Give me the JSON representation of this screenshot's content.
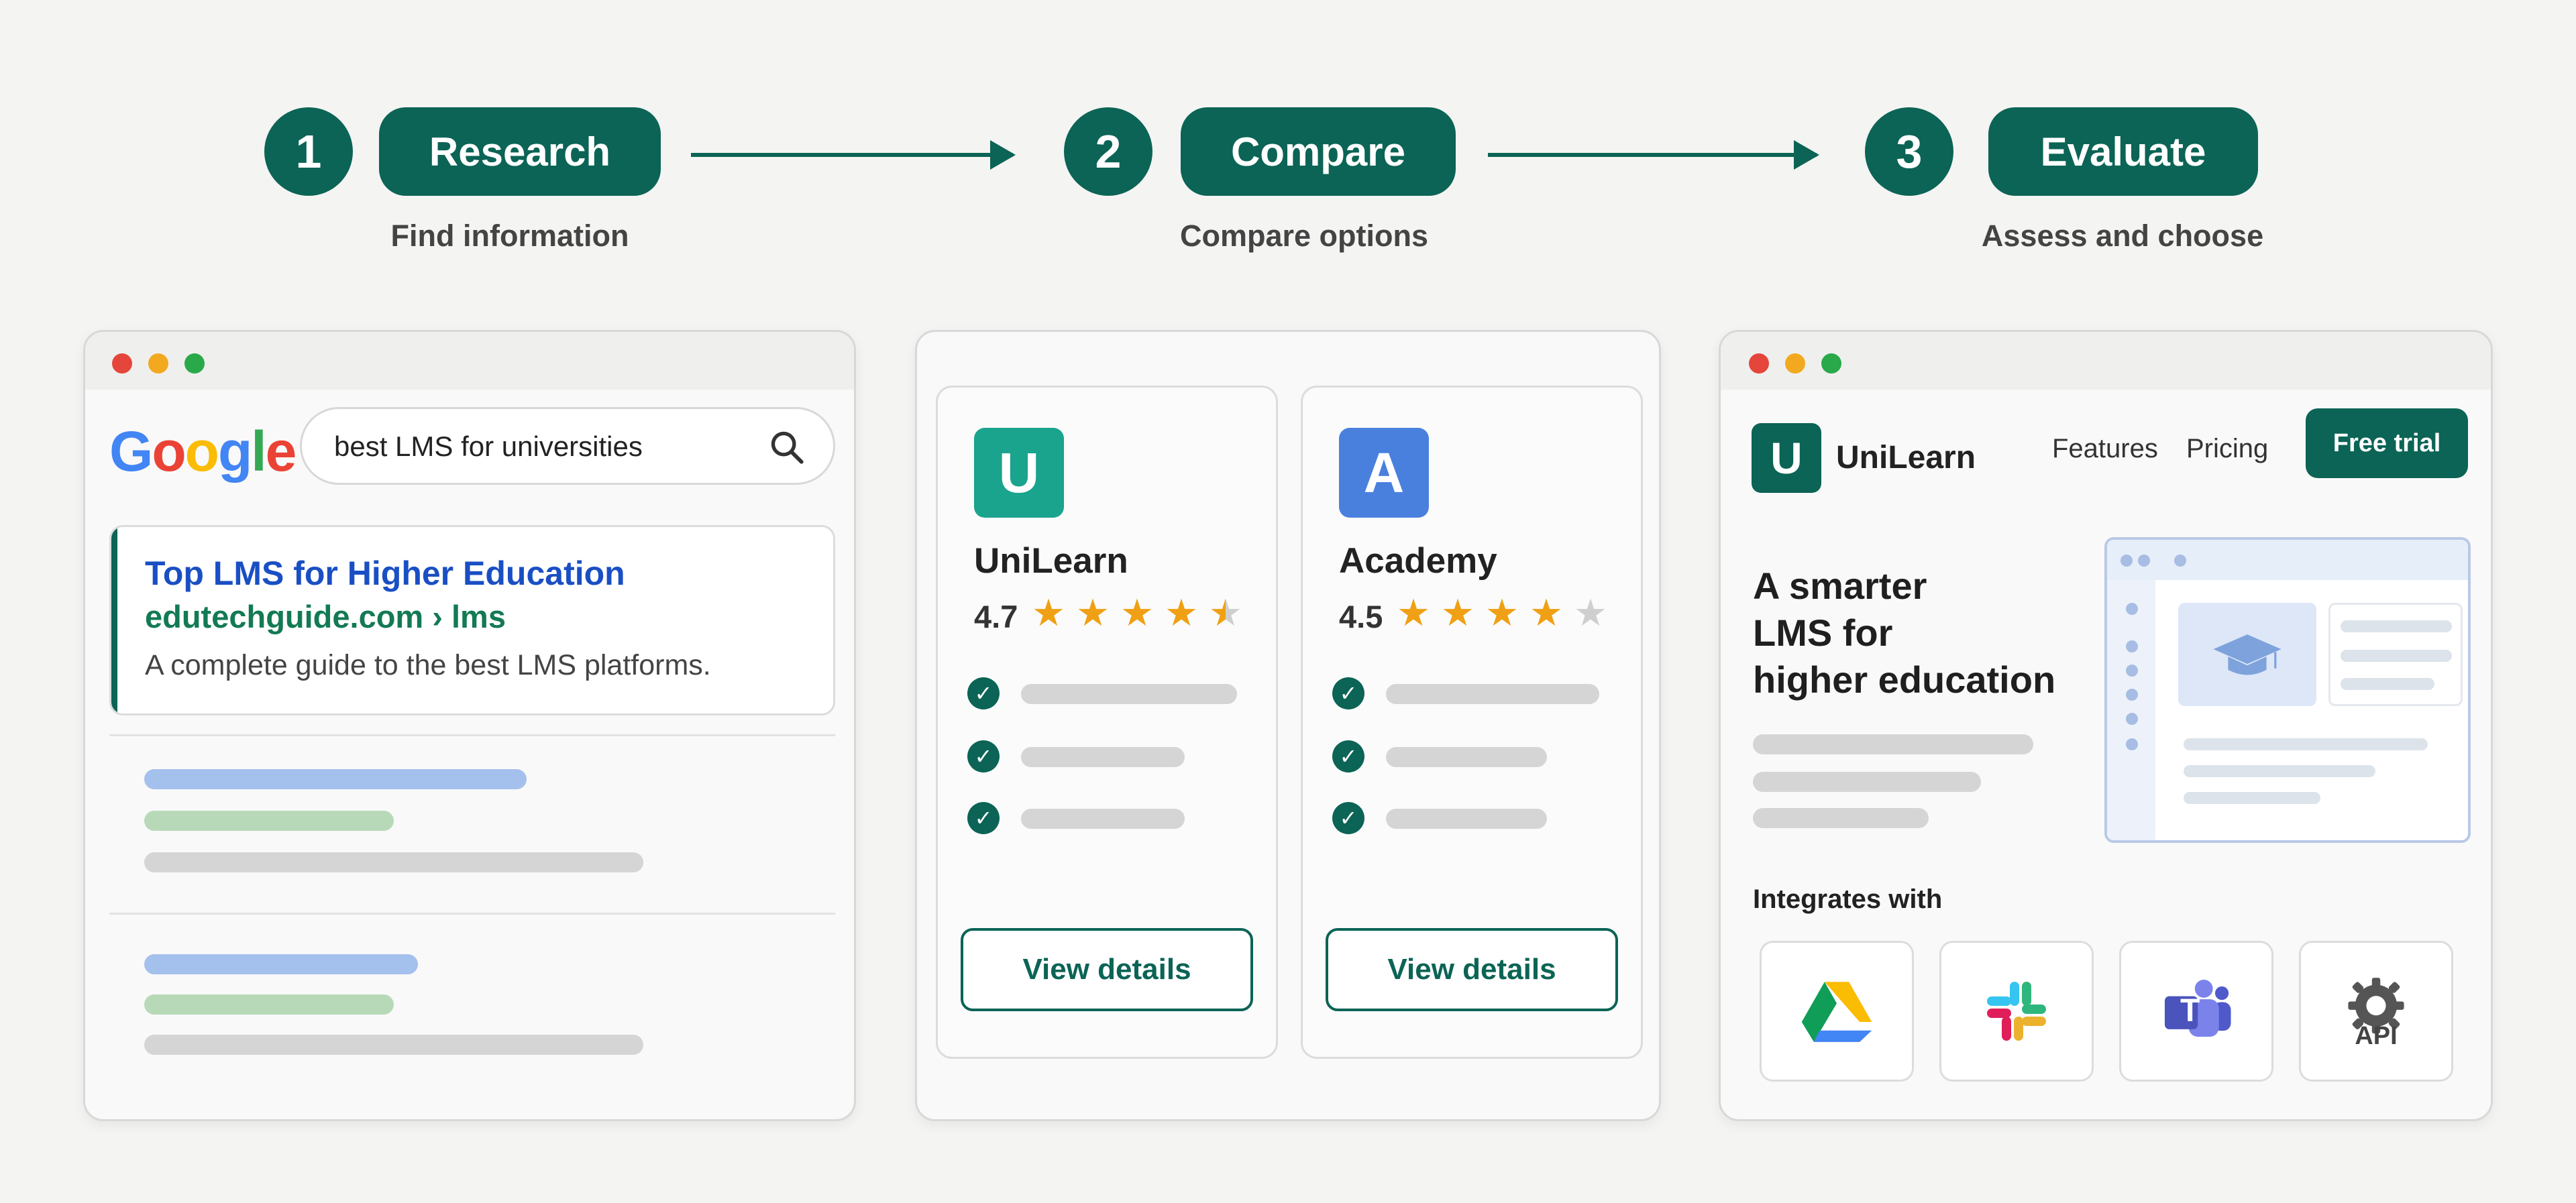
{
  "steps": [
    {
      "number": "1",
      "label": "Research",
      "caption": "Find information"
    },
    {
      "number": "2",
      "label": "Compare",
      "caption": "Compare options"
    },
    {
      "number": "3",
      "label": "Evaluate",
      "caption": "Assess and choose"
    }
  ],
  "research_panel": {
    "logo_letters": [
      "G",
      "o",
      "o",
      "g",
      "l",
      "e"
    ],
    "logo_colors": [
      "#4285F4",
      "#EA4335",
      "#FBBC05",
      "#4285F4",
      "#34A853",
      "#EA4335"
    ],
    "search_query": "best LMS for universities",
    "result": {
      "title": "Top LMS for Higher Education",
      "url": "edutechguide.com › lms",
      "description": "A complete guide to the best LMS platforms."
    }
  },
  "compare_panel": {
    "options": [
      {
        "initial": "U",
        "name": "UniLearn",
        "rating": "4.7",
        "stars": 4.5,
        "tile_color": "#1aa38d",
        "button": "View details"
      },
      {
        "initial": "A",
        "name": "Academy",
        "rating": "4.5",
        "stars": 4,
        "tile_color": "#4a80dd",
        "button": "View details"
      }
    ]
  },
  "evaluate_panel": {
    "logo_letter": "U",
    "brand": "UniLearn",
    "nav": [
      "Features",
      "Pricing"
    ],
    "cta": "Free trial",
    "headline": [
      "A smarter",
      "LMS for",
      "higher education"
    ],
    "integrates_label": "Integrates with",
    "integrations": [
      "google-drive-icon",
      "slack-icon",
      "teams-icon",
      "api-gear-icon"
    ],
    "api_label": "API",
    "teams_letter": "T"
  }
}
